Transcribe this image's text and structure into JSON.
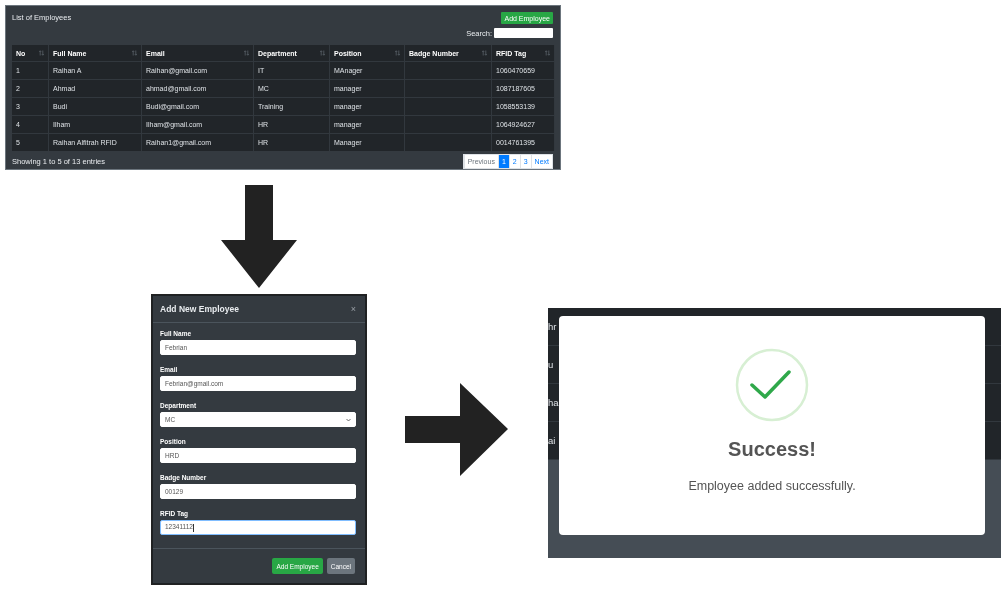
{
  "table_panel": {
    "title": "List of Employees",
    "add_button": "Add Employee",
    "search_label": "Search:",
    "columns": [
      {
        "label": "No"
      },
      {
        "label": "Full Name"
      },
      {
        "label": "Email"
      },
      {
        "label": "Department"
      },
      {
        "label": "Position"
      },
      {
        "label": "Badge Number"
      },
      {
        "label": "RFID Tag"
      }
    ],
    "rows": [
      {
        "cells": [
          "1",
          "Raihan A",
          "Raihan@gmail.com",
          "IT",
          "MAnager",
          "",
          "1060470659"
        ]
      },
      {
        "cells": [
          "2",
          "Ahmad",
          "ahmad@gmail.com",
          "MC",
          "manager",
          "",
          "1087187605"
        ]
      },
      {
        "cells": [
          "3",
          "Budi",
          "Budi@gmail.com",
          "Training",
          "manager",
          "",
          "1058553139"
        ]
      },
      {
        "cells": [
          "4",
          "Ilham",
          "Ilham@gmail.com",
          "HR",
          "manager",
          "",
          "1064924627"
        ]
      },
      {
        "cells": [
          "5",
          "Raihan Alfitrah RFID",
          "Raihan1@gmail.com",
          "HR",
          "Manager",
          "",
          "0014761395"
        ]
      }
    ],
    "info": "Showing 1 to 5 of 13 entries",
    "pagination": [
      {
        "label": "Previous",
        "selected": false,
        "disabled": true
      },
      {
        "label": "1",
        "selected": true,
        "disabled": false
      },
      {
        "label": "2",
        "selected": false,
        "disabled": false
      },
      {
        "label": "3",
        "selected": false,
        "disabled": false
      },
      {
        "label": "Next",
        "selected": false,
        "disabled": false
      }
    ]
  },
  "modal": {
    "title": "Add New Employee",
    "close": "×",
    "fields": [
      {
        "label": "Full Name",
        "kind": "text",
        "value": "Febrian",
        "focused": false
      },
      {
        "label": "Email",
        "kind": "text",
        "value": "Febrian@gmail.com",
        "focused": false
      },
      {
        "label": "Department",
        "kind": "select",
        "value": "MC",
        "focused": false
      },
      {
        "label": "Position",
        "kind": "text",
        "value": "HRD",
        "focused": false
      },
      {
        "label": "Badge Number",
        "kind": "text",
        "value": "00129",
        "focused": false
      },
      {
        "label": "RFID Tag",
        "kind": "text",
        "value": "12341112",
        "focused": true
      }
    ],
    "buttons": [
      {
        "label": "Add Employee",
        "kind": "primary"
      },
      {
        "label": "Cancel",
        "kind": "secondary"
      }
    ]
  },
  "success": {
    "background_rows": [
      "hr",
      "u",
      "ha",
      "ai"
    ],
    "title": "Success!",
    "message": "Employee added successfully."
  }
}
